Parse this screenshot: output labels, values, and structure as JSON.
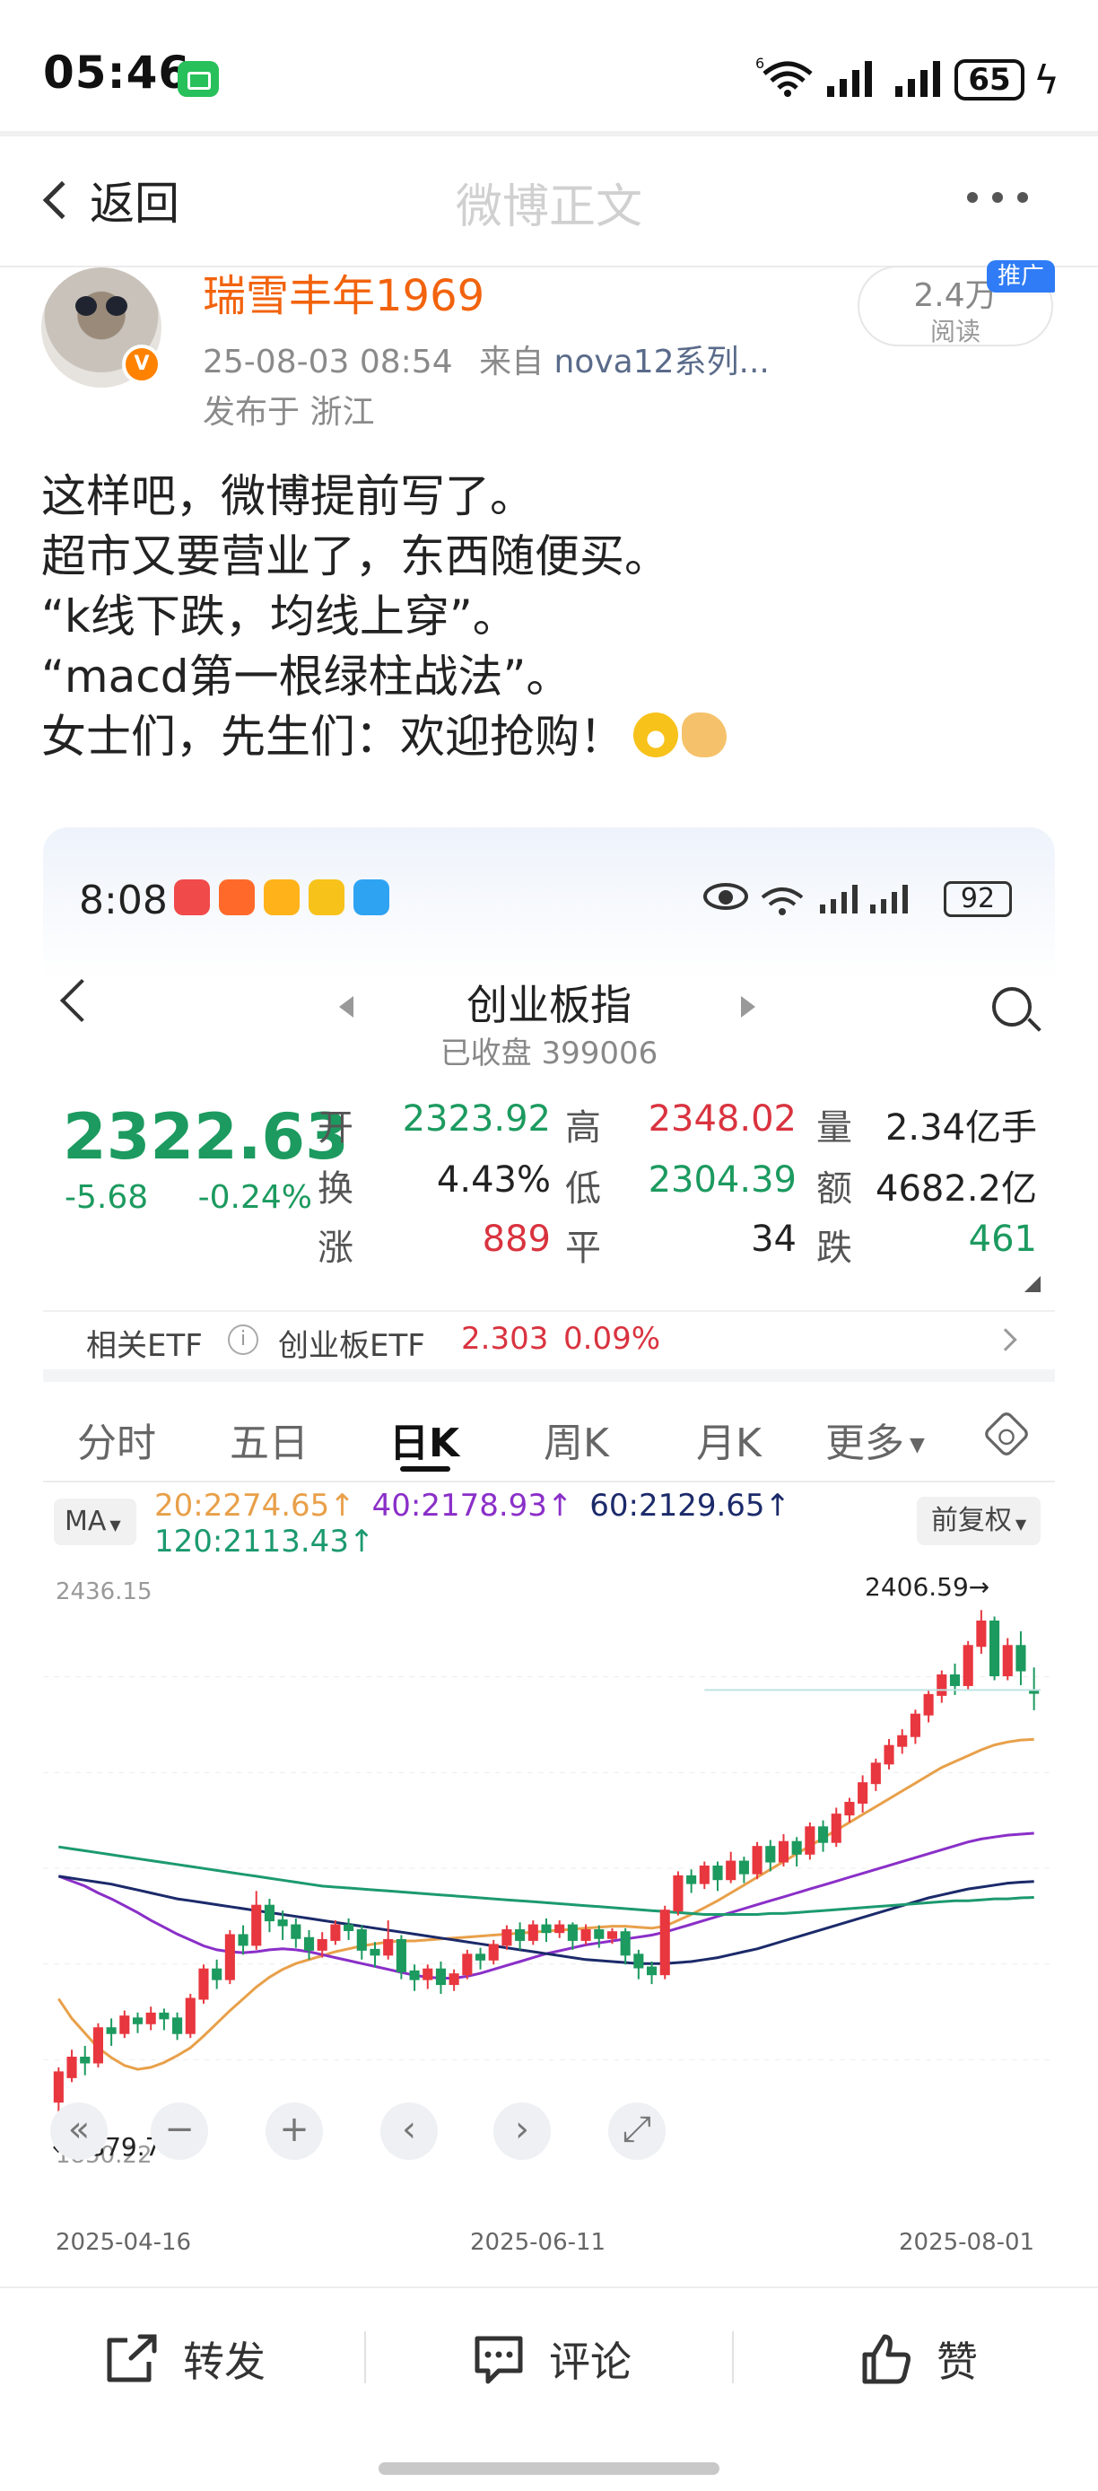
{
  "status_bar": {
    "time": "05:46",
    "battery": "65",
    "icons": [
      "wechat-icon",
      "wifi-6-icon",
      "signal-icon",
      "signal-icon",
      "charging-icon"
    ]
  },
  "nav": {
    "back_label": "返回",
    "title": "微博正文"
  },
  "post": {
    "username": "瑞雪丰年1969",
    "timestamp": "25-08-03 08:54",
    "source_prefix": "来自",
    "source": "nova12系列...",
    "location": "发布于 浙江",
    "read_count": "2.4万",
    "read_label": "阅读",
    "promo_tag": "推广",
    "verified": "V",
    "lines": [
      "这样吧，微博提前写了。",
      "超市又要营业了，东西随便买。",
      "“k线下跌，均线上穿”。",
      "“macd第一根绿柱战法”。",
      "女士们，先生们：欢迎抢购！"
    ],
    "emojis": [
      "grin-emoji-icon",
      "ok-hand-emoji-icon"
    ]
  },
  "embed": {
    "status_time": "8:08",
    "status_battery": "92",
    "title": "创业板指",
    "subtitle": "已收盘 399006",
    "price": "2322.63",
    "change": "-5.68",
    "change_pct": "-0.24%",
    "stats": {
      "open_label": "开",
      "open": "2323.92",
      "high_label": "高",
      "high": "2348.02",
      "volume_label": "量",
      "volume": "2.34亿手",
      "turnover_label": "换",
      "turnover": "4.43%",
      "low_label": "低",
      "low": "2304.39",
      "amount_label": "额",
      "amount": "4682.2亿",
      "up_label": "涨",
      "up": "889",
      "flat_label": "平",
      "flat": "34",
      "down_label": "跌",
      "down": "461"
    },
    "etf": {
      "label": "相关ETF",
      "info": "i",
      "name": "创业板ETF",
      "price": "2.303",
      "pct": "0.09%"
    },
    "tabs": [
      "分时",
      "五日",
      "日K",
      "周K",
      "月K",
      "更多"
    ],
    "ma_select": "MA",
    "adjust_select": "前复权",
    "ma_values": {
      "ma20": "20:2274.65↑",
      "ma40": "40:2178.93↑",
      "ma60": "60:2129.65↑",
      "ma120": "120:2113.43↑"
    },
    "colors": {
      "up": "#e8373f",
      "down": "#1c9a5f",
      "ma20": "#e8a04a",
      "ma40": "#8a2fc8",
      "ma60": "#1b2a6a",
      "ma120": "#1c9a6f"
    },
    "controls": [
      "«",
      "−",
      "+",
      "‹",
      "›",
      "⤢"
    ]
  },
  "chart_data": {
    "type": "candlestick",
    "title": "创业板指",
    "y_top_label": "2436.15",
    "y_bottom_label": "1850.22",
    "ylim": [
      1850.22,
      2436.15
    ],
    "x_labels": [
      "2025-04-16",
      "2025-06-11",
      "2025-08-01"
    ],
    "high_marker": "2406.59→",
    "low_marker": "←1879.78",
    "candles": [
      [
        1905,
        1935,
        1880,
        1940
      ],
      [
        1930,
        1950,
        1925,
        1958
      ],
      [
        1950,
        1945,
        1932,
        1962
      ],
      [
        1945,
        1980,
        1940,
        1985
      ],
      [
        1980,
        1975,
        1962,
        1990
      ],
      [
        1975,
        1992,
        1970,
        1998
      ],
      [
        1990,
        1985,
        1975,
        1996
      ],
      [
        1985,
        1995,
        1978,
        2002
      ],
      [
        1995,
        1990,
        1978,
        2000
      ],
      [
        1990,
        1975,
        1968,
        1996
      ],
      [
        1975,
        2010,
        1970,
        2015
      ],
      [
        2010,
        2040,
        2005,
        2045
      ],
      [
        2040,
        2030,
        2020,
        2050
      ],
      [
        2030,
        2075,
        2025,
        2080
      ],
      [
        2075,
        2065,
        2055,
        2085
      ],
      [
        2065,
        2105,
        2060,
        2120
      ],
      [
        2105,
        2090,
        2078,
        2112
      ],
      [
        2090,
        2085,
        2070,
        2100
      ],
      [
        2085,
        2072,
        2062,
        2092
      ],
      [
        2072,
        2060,
        2050,
        2080
      ],
      [
        2060,
        2070,
        2052,
        2078
      ],
      [
        2070,
        2085,
        2065,
        2090
      ],
      [
        2085,
        2080,
        2070,
        2092
      ],
      [
        2080,
        2060,
        2050,
        2085
      ],
      [
        2060,
        2055,
        2042,
        2068
      ],
      [
        2055,
        2070,
        2050,
        2090
      ],
      [
        2070,
        2038,
        2030,
        2075
      ],
      [
        2038,
        2030,
        2018,
        2045
      ],
      [
        2030,
        2040,
        2020,
        2045
      ],
      [
        2040,
        2025,
        2015,
        2048
      ],
      [
        2025,
        2035,
        2018,
        2040
      ],
      [
        2035,
        2055,
        2030,
        2060
      ],
      [
        2055,
        2050,
        2040,
        2062
      ],
      [
        2050,
        2065,
        2045,
        2070
      ],
      [
        2065,
        2080,
        2060,
        2085
      ],
      [
        2080,
        2070,
        2060,
        2088
      ],
      [
        2070,
        2085,
        2065,
        2090
      ],
      [
        2085,
        2078,
        2068,
        2092
      ],
      [
        2078,
        2085,
        2072,
        2090
      ],
      [
        2085,
        2070,
        2060,
        2088
      ],
      [
        2070,
        2080,
        2065,
        2086
      ],
      [
        2080,
        2072,
        2062,
        2085
      ],
      [
        2072,
        2078,
        2066,
        2082
      ],
      [
        2078,
        2055,
        2045,
        2082
      ],
      [
        2055,
        2042,
        2030,
        2060
      ],
      [
        2042,
        2035,
        2025,
        2048
      ],
      [
        2035,
        2100,
        2030,
        2105
      ],
      [
        2100,
        2135,
        2095,
        2140
      ],
      [
        2135,
        2128,
        2118,
        2142
      ],
      [
        2128,
        2145,
        2122,
        2150
      ],
      [
        2145,
        2132,
        2120,
        2150
      ],
      [
        2132,
        2150,
        2128,
        2160
      ],
      [
        2150,
        2138,
        2128,
        2155
      ],
      [
        2138,
        2165,
        2132,
        2170
      ],
      [
        2165,
        2150,
        2140,
        2172
      ],
      [
        2150,
        2170,
        2145,
        2178
      ],
      [
        2170,
        2158,
        2145,
        2175
      ],
      [
        2158,
        2185,
        2152,
        2190
      ],
      [
        2185,
        2170,
        2160,
        2192
      ],
      [
        2170,
        2198,
        2165,
        2205
      ],
      [
        2198,
        2210,
        2190,
        2215
      ],
      [
        2210,
        2230,
        2200,
        2238
      ],
      [
        2230,
        2250,
        2222,
        2255
      ],
      [
        2250,
        2268,
        2244,
        2275
      ],
      [
        2268,
        2278,
        2260,
        2285
      ],
      [
        2278,
        2300,
        2270,
        2305
      ],
      [
        2300,
        2320,
        2292,
        2325
      ],
      [
        2320,
        2340,
        2312,
        2345
      ],
      [
        2340,
        2330,
        2320,
        2352
      ],
      [
        2330,
        2370,
        2325,
        2375
      ],
      [
        2370,
        2395,
        2362,
        2406.59
      ],
      [
        2395,
        2340,
        2335,
        2400
      ],
      [
        2340,
        2370,
        2335,
        2378
      ],
      [
        2370,
        2345,
        2330,
        2385
      ],
      [
        2323.92,
        2322.63,
        2304.39,
        2348.02
      ]
    ],
    "series": [
      {
        "name": "MA20",
        "values": [
          2010,
          1990,
          1975,
          1960,
          1950,
          1942,
          1938,
          1940,
          1945,
          1952,
          1960,
          1972,
          1985,
          1998,
          2010,
          2022,
          2032,
          2040,
          2046,
          2050,
          2054,
          2058,
          2061,
          2064,
          2066,
          2068,
          2069,
          2069,
          2070,
          2071,
          2072,
          2073,
          2074,
          2075,
          2076,
          2077,
          2078,
          2079,
          2080,
          2081,
          2082,
          2083,
          2084,
          2084,
          2083,
          2082,
          2084,
          2090,
          2096,
          2103,
          2110,
          2118,
          2126,
          2134,
          2142,
          2150,
          2158,
          2166,
          2174,
          2182,
          2190,
          2198,
          2206,
          2214,
          2222,
          2230,
          2238,
          2246,
          2252,
          2258,
          2264,
          2269,
          2272,
          2274,
          2274.65
        ]
      },
      {
        "name": "MA40",
        "values": [
          2135,
          2130,
          2125,
          2118,
          2112,
          2105,
          2098,
          2090,
          2083,
          2076,
          2070,
          2064,
          2060,
          2058,
          2057,
          2058,
          2060,
          2061,
          2060,
          2058,
          2055,
          2052,
          2049,
          2046,
          2043,
          2040,
          2037,
          2034,
          2032,
          2031,
          2031,
          2033,
          2036,
          2040,
          2044,
          2048,
          2052,
          2056,
          2059,
          2062,
          2065,
          2067,
          2069,
          2071,
          2073,
          2075,
          2078,
          2082,
          2086,
          2090,
          2094,
          2098,
          2102,
          2106,
          2110,
          2114,
          2118,
          2122,
          2126,
          2130,
          2134,
          2138,
          2142,
          2146,
          2150,
          2154,
          2158,
          2162,
          2166,
          2170,
          2173,
          2175,
          2177,
          2178,
          2178.93
        ]
      },
      {
        "name": "MA60",
        "values": [
          2135,
          2133,
          2131,
          2129,
          2127,
          2124,
          2121,
          2118,
          2115,
          2112,
          2110,
          2108,
          2106,
          2104,
          2102,
          2100,
          2098,
          2096,
          2094,
          2092,
          2090,
          2088,
          2086,
          2084,
          2082,
          2080,
          2078,
          2076,
          2074,
          2072,
          2070,
          2068,
          2066,
          2064,
          2062,
          2060,
          2058,
          2056,
          2054,
          2052,
          2050,
          2049,
          2048,
          2047,
          2046,
          2046,
          2046,
          2047,
          2048,
          2050,
          2052,
          2055,
          2058,
          2061,
          2065,
          2069,
          2073,
          2077,
          2081,
          2085,
          2089,
          2093,
          2097,
          2101,
          2105,
          2109,
          2113,
          2116,
          2119,
          2122,
          2124,
          2126,
          2128,
          2129,
          2129.65
        ]
      },
      {
        "name": "MA120",
        "values": [
          2165,
          2163,
          2161,
          2159,
          2157,
          2155,
          2153,
          2151,
          2149,
          2147,
          2145,
          2143,
          2141,
          2139,
          2137,
          2135,
          2133,
          2131,
          2129,
          2127,
          2125,
          2124,
          2123,
          2122,
          2121,
          2120,
          2119,
          2118,
          2117,
          2116,
          2115,
          2114,
          2113,
          2112,
          2111,
          2110,
          2109,
          2108,
          2107,
          2106,
          2105,
          2104,
          2103,
          2102,
          2101,
          2100,
          2099,
          2098,
          2097,
          2096,
          2096,
          2096,
          2096,
          2096,
          2097,
          2097,
          2098,
          2099,
          2100,
          2101,
          2102,
          2103,
          2104,
          2105,
          2106,
          2107,
          2108,
          2109,
          2110,
          2110,
          2111,
          2112,
          2112,
          2113,
          2113.43
        ]
      }
    ],
    "ref_line": 2325
  },
  "actions": {
    "repost": "转发",
    "comment": "评论",
    "like": "赞"
  }
}
